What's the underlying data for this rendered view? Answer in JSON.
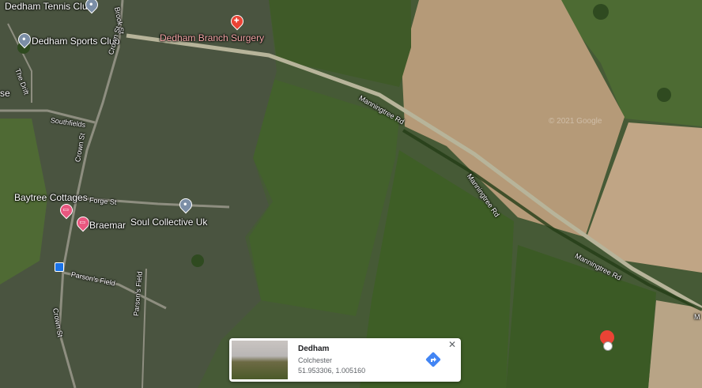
{
  "map": {
    "labels": {
      "tennis_club": "Dedham Tennis Club",
      "sports_club": "Dedham Sports Club",
      "branch_surgery": "Dedham Branch Surgery",
      "brook_st": "Brook St",
      "crown_st_1": "Crown St",
      "crown_st_2": "Crown St",
      "crown_st_3": "Crown St",
      "the_drift": "The Drift",
      "southfields": "Southfields",
      "baytree": "Baytree Cottages",
      "forge_st": "Forge St",
      "soul_collective": "Soul Collective Uk",
      "braemar": "Braemar",
      "parsons_field": "Parson's Field",
      "parson_field_v": "Parson's Field",
      "manningtree_1": "Manningtree Rd",
      "manningtree_2": "Manningtree Rd",
      "manningtree_3": "Manningtree Rd",
      "se": "se",
      "edge_m": "M"
    },
    "watermark": "© 2021 Google"
  },
  "info_card": {
    "title": "Dedham",
    "subtitle": "Colchester",
    "coordinates": "51.953306, 1.005160",
    "close_label": "✕"
  },
  "colors": {
    "pin_red": "#ea4335",
    "pin_pink": "#e8577f",
    "pin_grey": "#7b8ea6",
    "directions_blue": "#4285f4"
  }
}
